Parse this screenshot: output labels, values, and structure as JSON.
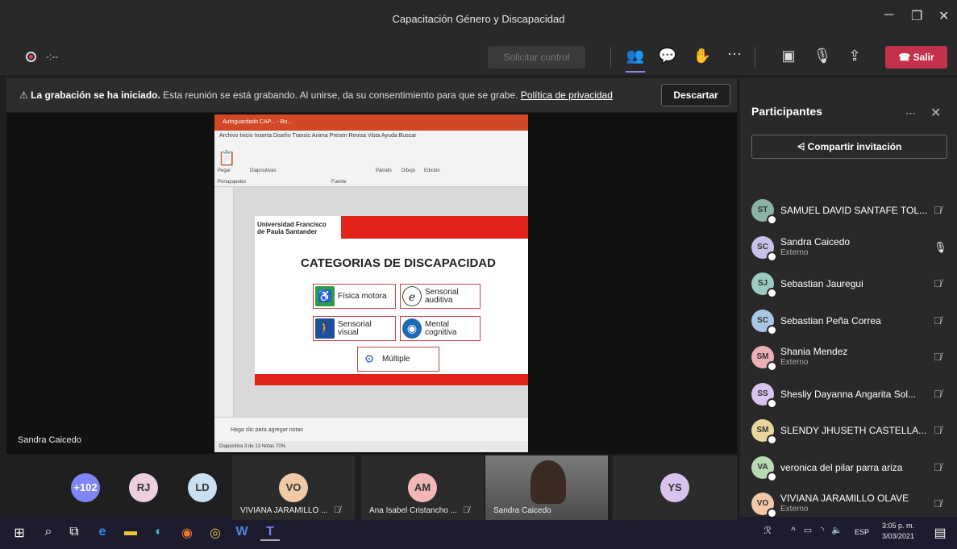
{
  "window": {
    "title": "Capacitación Género y Discapacidad",
    "minimize": "─",
    "maximize": "❐",
    "close": "✕"
  },
  "toolbar": {
    "timer": "-:--",
    "request_control": "Solicitar control",
    "leave": "Salir"
  },
  "banner": {
    "bold": "La grabación se ha iniciado.",
    "text": "Esta reunión se está grabando. Al unirse, da su consentimiento para que se grabe.",
    "link": "Política de privacidad",
    "dismiss": "Descartar"
  },
  "stage": {
    "speaker": "Sandra Caicedo"
  },
  "shared_screen": {
    "app_title": "Autoguardado  CAP... - Ro...",
    "menu": "Archivo  Inicio  Inserta  Diseño  Transic  Anima  Presen  Revisa  Vista  Ayuda     Buscar",
    "ribbon_labels": [
      "Pegar",
      "Diapositivas",
      "Fuente",
      "Párrafo",
      "Dibujo",
      "Edición",
      "Portapapeles"
    ],
    "slide": {
      "university": "Universidad Francisco de Paula Santander",
      "title": "CATEGORIAS DE DISCAPACIDAD",
      "categories": [
        {
          "label": "Física motora",
          "icon": "wheelchair-icon"
        },
        {
          "label": "Sensorial auditiva",
          "icon": "ear-icon"
        },
        {
          "label": "Sensorial visual",
          "icon": "blind-person-icon"
        },
        {
          "label": "Mental cognitiva",
          "icon": "head-icon"
        },
        {
          "label": "Múltiple",
          "icon": "gears-icon"
        }
      ]
    },
    "notes_placeholder": "Haga clic para agregar notas",
    "status": "Diapositiva 3 de 13        Notas                             70%"
  },
  "panel": {
    "title": "Participantes",
    "share_invite": "Compartir invitación",
    "participants": [
      {
        "initials": "ST",
        "name": "SAMUEL DAVID SANTAFE TOL...",
        "sub": "",
        "color": "#8bb3a4",
        "muted": true
      },
      {
        "initials": "SC",
        "name": "Sandra Caicedo",
        "sub": "Externo",
        "color": "#c8c2e8",
        "muted": false
      },
      {
        "initials": "SJ",
        "name": "Sebastian Jauregui",
        "sub": "",
        "color": "#9cc9c1",
        "muted": true
      },
      {
        "initials": "SC",
        "name": "Sebastian Peña Correa",
        "sub": "",
        "color": "#a9c6e5",
        "muted": true
      },
      {
        "initials": "SM",
        "name": "Shania Mendez",
        "sub": "Externo",
        "color": "#eab0b6",
        "muted": true
      },
      {
        "initials": "SS",
        "name": "Shesliy Dayanna Angarita Sol...",
        "sub": "",
        "color": "#d9c4ef",
        "muted": true
      },
      {
        "initials": "SM",
        "name": "SLENDY JHUSETH CASTELLA...",
        "sub": "",
        "color": "#ead59a",
        "muted": true
      },
      {
        "initials": "VA",
        "name": "veronica del pilar parra ariza",
        "sub": "",
        "color": "#b7dab5",
        "muted": true
      },
      {
        "initials": "VO",
        "name": "VIVIANA JARAMILLO OLAVE",
        "sub": "Externo",
        "color": "#f2c9a6",
        "muted": true
      }
    ]
  },
  "strip": {
    "avatars": [
      {
        "initials": "+102",
        "color": "#7f85f5"
      },
      {
        "initials": "RJ",
        "color": "#eecfe0"
      },
      {
        "initials": "LD",
        "color": "#c9dff2"
      }
    ],
    "tiles": [
      {
        "initials": "VO",
        "name": "VIVIANA JARAMILLO ...",
        "color": "#f2c9a6"
      },
      {
        "initials": "AM",
        "name": "Ana Isabel Cristancho ...",
        "color": "#f2b6b6"
      },
      {
        "initials": "",
        "name": "Sandra Caicedo",
        "color": "#6a6a6a"
      },
      {
        "initials": "YS",
        "name": "",
        "color": "#d9c4ef"
      }
    ]
  },
  "taskbar": {
    "lang": "ESP",
    "time": "3:05 p. m.",
    "date": "3/03/2021"
  }
}
